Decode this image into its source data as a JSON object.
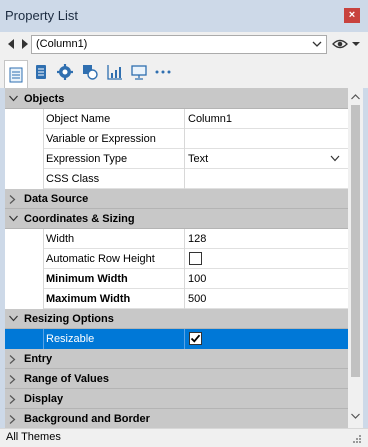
{
  "window": {
    "title": "Property List",
    "close_glyph": "×"
  },
  "selector": {
    "value": "(Column1)"
  },
  "toolbar": {
    "tools": [
      {
        "icon": "properties-list-icon"
      },
      {
        "icon": "data-icon"
      },
      {
        "icon": "settings-icon"
      },
      {
        "icon": "shapes-icon"
      },
      {
        "icon": "chart-icon"
      },
      {
        "icon": "display-icon"
      },
      {
        "icon": "more-icon"
      }
    ]
  },
  "grid": {
    "objects": {
      "label": "Objects"
    },
    "object_name": {
      "label": "Object Name",
      "value": "Column1"
    },
    "variable": {
      "label": "Variable or Expression",
      "value": ""
    },
    "expression_type": {
      "label": "Expression Type",
      "value": "Text"
    },
    "css_class": {
      "label": "CSS Class",
      "value": ""
    },
    "data_source": {
      "label": "Data Source"
    },
    "coordinates": {
      "label": "Coordinates & Sizing"
    },
    "width": {
      "label": "Width",
      "value": "128"
    },
    "auto_row_height": {
      "label": "Automatic Row Height",
      "checked": false
    },
    "min_width": {
      "label": "Minimum Width",
      "value": "100"
    },
    "max_width": {
      "label": "Maximum Width",
      "value": "500"
    },
    "resizing": {
      "label": "Resizing Options"
    },
    "resizable": {
      "label": "Resizable",
      "checked": true
    },
    "entry": {
      "label": "Entry"
    },
    "range": {
      "label": "Range of Values"
    },
    "display": {
      "label": "Display"
    },
    "background": {
      "label": "Background and Border"
    }
  },
  "status": {
    "text": "All Themes"
  },
  "colors": {
    "title_bg": "#cdd9e8",
    "close": "#c8423d",
    "category_bg": "#c8c8c8",
    "selection": "#0078d7"
  }
}
